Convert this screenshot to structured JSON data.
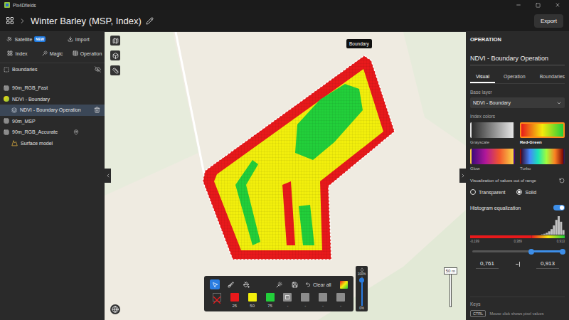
{
  "window": {
    "title": "Pix4Dfields"
  },
  "header": {
    "title": "Winter Barley (MSP, Index)",
    "export_button": "Export"
  },
  "sidebar": {
    "tool_rows": [
      {
        "items": [
          {
            "label": "Satellite",
            "badge": "NEW",
            "kind": "satellite"
          },
          {
            "label": "Import",
            "kind": "import"
          }
        ]
      },
      {
        "items": [
          {
            "label": "Index",
            "kind": "index"
          },
          {
            "label": "Magic",
            "kind": "magic"
          },
          {
            "label": "Operation",
            "kind": "operation"
          }
        ]
      }
    ],
    "boundaries": {
      "label": "Boundaries",
      "visible": false
    },
    "layers": [
      {
        "name": "90m_RGB_Fast",
        "kind": "raster",
        "child": false,
        "selected": false,
        "pinned": false
      },
      {
        "name": "NDVI - Boundary",
        "kind": "index",
        "child": false,
        "selected": false,
        "pinned": false
      },
      {
        "name": "NDVI - Boundary Operation",
        "kind": "operation",
        "child": true,
        "selected": true,
        "pinned": false
      },
      {
        "name": "90m_MSP",
        "kind": "raster",
        "child": false,
        "selected": false,
        "pinned": false
      },
      {
        "name": "90m_RGB_Accurate",
        "kind": "raster",
        "child": false,
        "selected": false,
        "pinned": true
      },
      {
        "name": "Surface model",
        "kind": "surface",
        "child": true,
        "selected": false,
        "pinned": false
      }
    ]
  },
  "map": {
    "tooltip": "Boundary",
    "scale": "50 m"
  },
  "draw_toolbar": {
    "tools": [
      {
        "kind": "select",
        "selected": true
      },
      {
        "kind": "brush",
        "selected": false
      },
      {
        "kind": "fill",
        "selected": false
      },
      {
        "kind": "magic",
        "selected": false
      },
      {
        "kind": "save",
        "selected": false
      }
    ],
    "clear_label": "Clear all",
    "palette": [
      {
        "kind": "none"
      },
      {
        "kind": "class",
        "label": "25",
        "color": "#e8191b"
      },
      {
        "kind": "class",
        "label": "50",
        "color": "#f2ef0c"
      },
      {
        "kind": "class",
        "label": "75",
        "color": "#22cf3a"
      },
      {
        "kind": "pattern",
        "label": "-",
        "color": "#8c8c8c"
      },
      {
        "kind": "class",
        "label": "-",
        "color": "#8c8c8c"
      },
      {
        "kind": "class",
        "label": "-",
        "color": "#8c8c8c"
      },
      {
        "kind": "class",
        "label": "-",
        "color": "#8c8c8c"
      }
    ],
    "opacity": {
      "top": "100%",
      "bottom": "0%",
      "level": 0.88
    }
  },
  "panel": {
    "header": "OPERATION",
    "name": "NDVI - Boundary Operation",
    "tabs": [
      {
        "label": "Visual",
        "selected": true
      },
      {
        "label": "Operation",
        "selected": false
      },
      {
        "label": "Boundaries",
        "selected": false
      }
    ],
    "base_layer": {
      "label": "Base layer",
      "value": "NDVI - Boundary"
    },
    "index_colors": {
      "label": "Index colors",
      "options": [
        {
          "label": "Grayscale",
          "selected": false,
          "colors": [
            "#2b2b2b",
            "#e6e6e6"
          ]
        },
        {
          "label": "Red-Green",
          "selected": true,
          "colors": [
            "#e8191b",
            "#f5e90c",
            "#22cf3a"
          ]
        },
        {
          "label": "Glow",
          "selected": false,
          "colors": [
            "#3b0a7a",
            "#b0179a",
            "#f2572c",
            "#f9d649"
          ]
        },
        {
          "label": "Turbo",
          "selected": false,
          "colors": [
            "#30123b",
            "#4686fb",
            "#1be5b5",
            "#a2fc3c",
            "#fb8022",
            "#7a0403"
          ]
        }
      ]
    },
    "out_of_range": {
      "label": "Visualization of values out of range",
      "options": [
        {
          "label": "Transparent",
          "selected": false
        },
        {
          "label": "Solid",
          "selected": true
        }
      ]
    },
    "histogram": {
      "label": "Histogram equalization",
      "on": true,
      "values": [
        0,
        0,
        0,
        0,
        0,
        0,
        0,
        0,
        0,
        0,
        0,
        0,
        0,
        0,
        0,
        0,
        0,
        0,
        0,
        0,
        0,
        0,
        0,
        0,
        0,
        0,
        0,
        0,
        0,
        0,
        2,
        5,
        10,
        18,
        30,
        50,
        80,
        100,
        70,
        25
      ],
      "ticks": [
        "-0,199",
        "0,389",
        "0,913"
      ],
      "min": "0,761",
      "max": "0,913",
      "low": 0.65,
      "high": 1.0
    },
    "keys": {
      "label": "Keys",
      "key": "CTRL",
      "description": "Mouse click shows pixel values"
    }
  }
}
